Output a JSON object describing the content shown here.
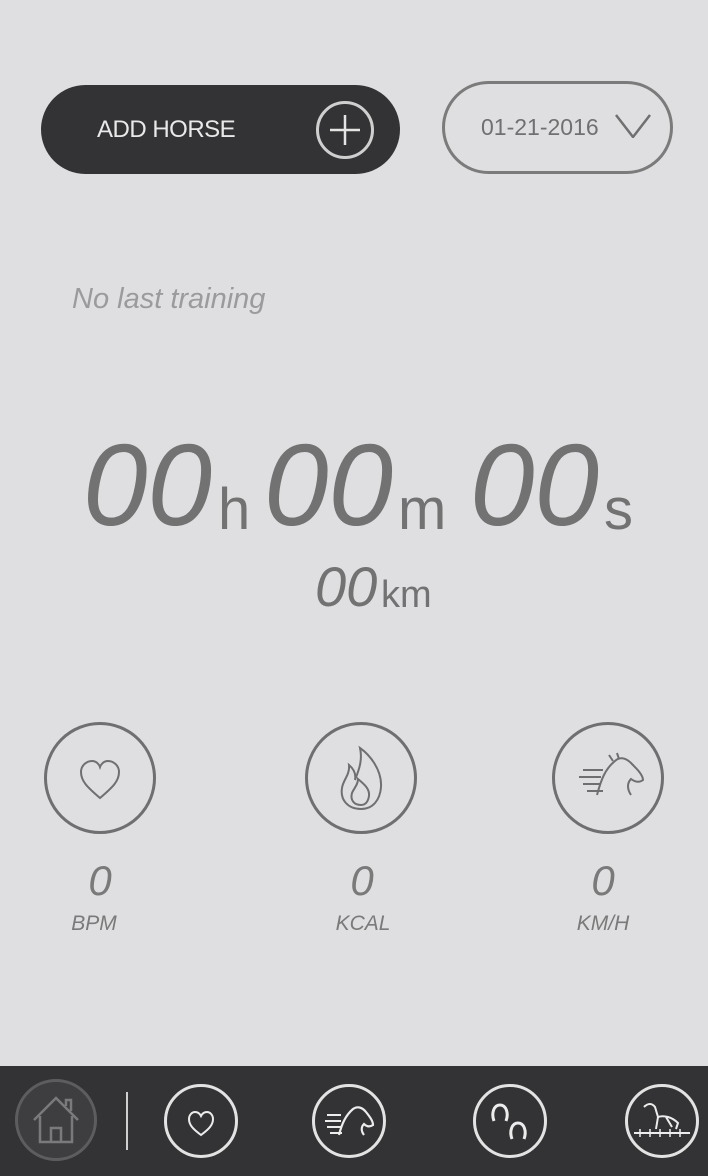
{
  "header": {
    "add_horse_label": "ADD HORSE",
    "date_value": "01-21-2016"
  },
  "status": {
    "last_training": "No last training"
  },
  "timer": {
    "hours": "00",
    "hours_unit": "h",
    "minutes": "00",
    "minutes_unit": "m",
    "seconds": "00",
    "seconds_unit": "s"
  },
  "distance": {
    "value": "00",
    "unit": "km"
  },
  "stats": [
    {
      "icon": "heart-icon",
      "value": "0",
      "unit": "BPM"
    },
    {
      "icon": "flame-icon",
      "value": "0",
      "unit": "KCAL"
    },
    {
      "icon": "galloping-horse-icon",
      "value": "0",
      "unit": "KM/H"
    }
  ],
  "bottom_nav": [
    {
      "icon": "home-icon"
    },
    {
      "icon": "heart-icon"
    },
    {
      "icon": "horse-speed-icon"
    },
    {
      "icon": "horseshoes-icon"
    },
    {
      "icon": "horse-jumping-icon"
    }
  ],
  "colors": {
    "background": "#dfdfe1",
    "dark": "#333335",
    "text_gray": "#727273"
  }
}
